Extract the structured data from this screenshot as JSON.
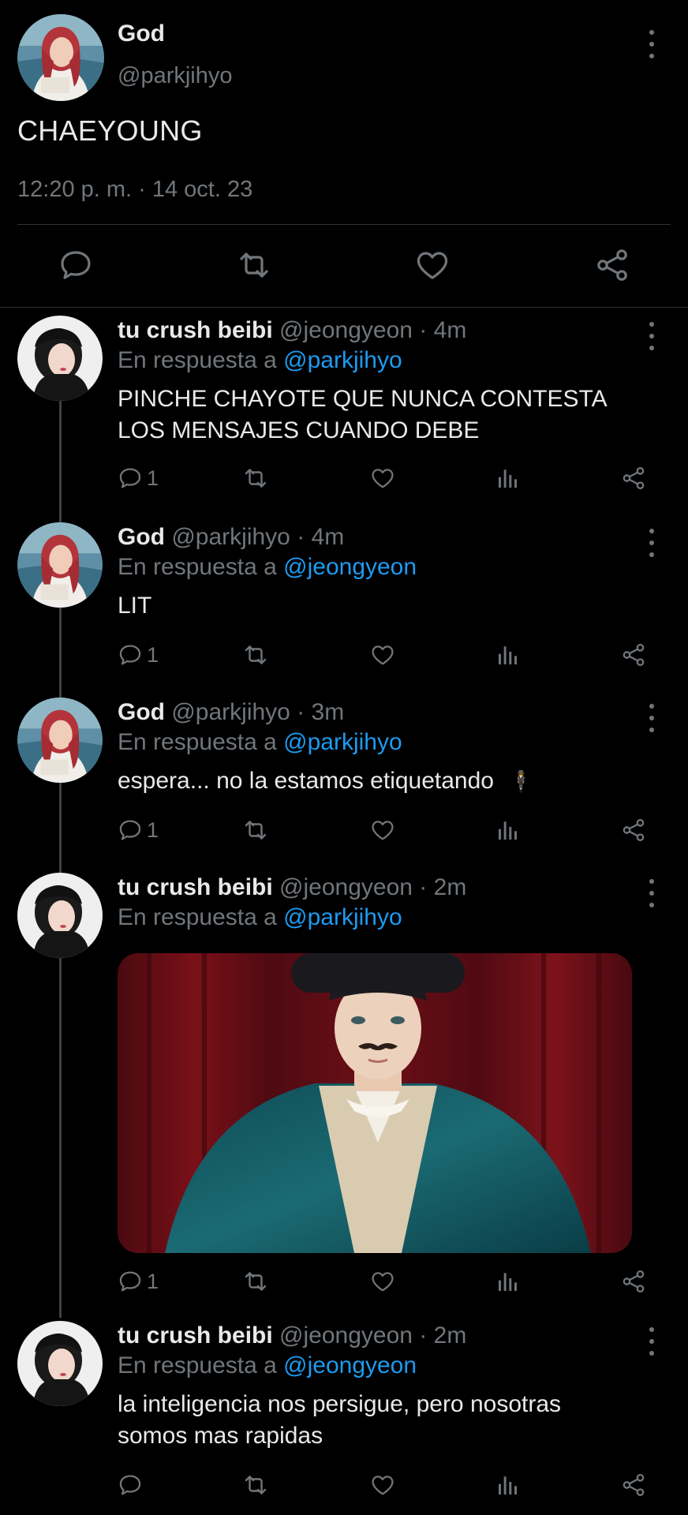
{
  "main": {
    "name": "God",
    "handle": "@parkjihyo",
    "text": "CHAEYOUNG",
    "meta": "12:20 p. m. · 14 oct. 23",
    "icons": [
      "reply-icon",
      "retweet-icon",
      "like-icon",
      "share-icon"
    ]
  },
  "replies": [
    {
      "name": "tu crush beibi",
      "handle": "@jeongyeon",
      "time": "4m",
      "replying_label": "En respuesta a",
      "mention": "@parkjihyo",
      "text_lines": [
        "PINCHE CHAYOTE QUE NUNCA CONTESTA",
        "LOS MENSAJES CUANDO DEBE"
      ],
      "reply_count": "1"
    },
    {
      "name": "God",
      "handle": "@parkjihyo",
      "time": "4m",
      "replying_label": "En respuesta a",
      "mention": "@jeongyeon",
      "text_lines": [
        "LIT"
      ],
      "reply_count": "1"
    },
    {
      "name": "God",
      "handle": "@parkjihyo",
      "time": "3m",
      "replying_label": "En respuesta a",
      "mention": "@parkjihyo",
      "text_lines": [
        "espera... no la estamos etiquetando"
      ],
      "emoji": "🕴",
      "reply_count": "1"
    },
    {
      "name": "tu crush beibi",
      "handle": "@jeongyeon",
      "time": "2m",
      "replying_label": "En respuesta a",
      "mention": "@parkjihyo",
      "media": "image of a man in a top hat with a drawn mustache and a teal cape in front of red curtains",
      "reply_count": "1"
    },
    {
      "name": "tu crush beibi",
      "handle": "@jeongyeon",
      "time": "2m",
      "replying_label": "En respuesta a",
      "mention": "@jeongyeon",
      "text_lines": [
        "la inteligencia nos persigue, pero nosotras",
        "somos mas rapidas"
      ],
      "reply_count": ""
    }
  ],
  "separator": "·",
  "colors": {
    "background": "#000000",
    "text": "#e7e9ea",
    "muted": "#71767b",
    "accent": "#1d9bf0",
    "divider": "#2f3336"
  }
}
